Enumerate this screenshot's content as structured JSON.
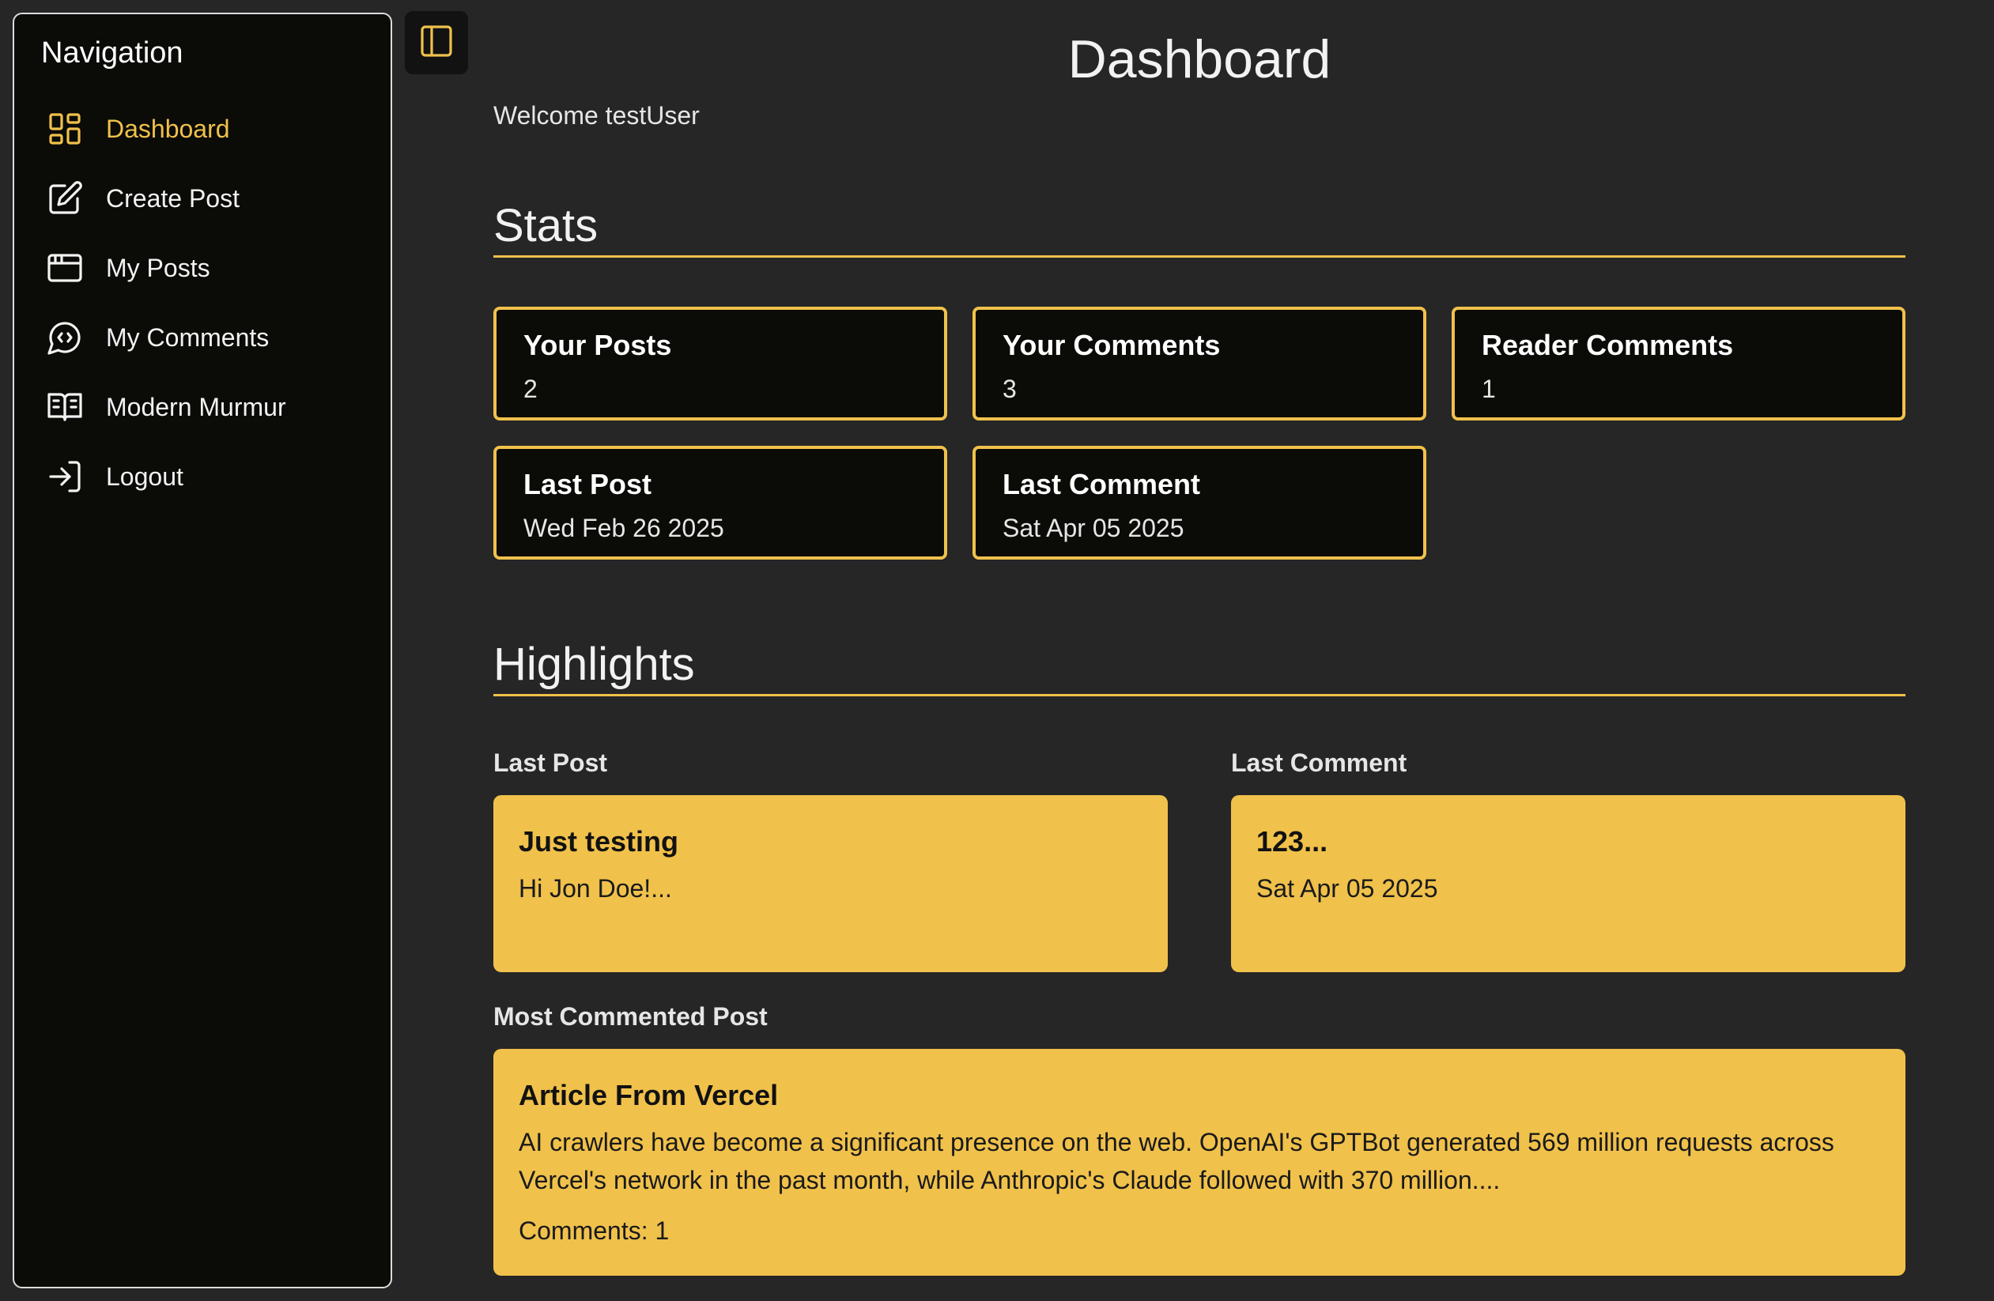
{
  "sidebar": {
    "title": "Navigation",
    "items": [
      {
        "label": "Dashboard",
        "icon": "dashboard-icon",
        "active": true
      },
      {
        "label": "Create Post",
        "icon": "edit-icon"
      },
      {
        "label": "My Posts",
        "icon": "window-icon"
      },
      {
        "label": "My Comments",
        "icon": "comment-icon"
      },
      {
        "label": "Modern Murmur",
        "icon": "book-icon"
      },
      {
        "label": "Logout",
        "icon": "logout-icon"
      }
    ]
  },
  "toolbar": {
    "toggle_icon": "sidebar-toggle-icon"
  },
  "page": {
    "title": "Dashboard",
    "welcome": "Welcome testUser"
  },
  "stats": {
    "heading": "Stats",
    "cards": [
      {
        "label": "Your Posts",
        "value": "2"
      },
      {
        "label": "Your Comments",
        "value": "3"
      },
      {
        "label": "Reader Comments",
        "value": "1"
      },
      {
        "label": "Last Post",
        "value": "Wed Feb 26 2025"
      },
      {
        "label": "Last Comment",
        "value": "Sat Apr 05 2025"
      }
    ]
  },
  "highlights": {
    "heading": "Highlights",
    "last_post": {
      "label": "Last Post",
      "title": "Just testing",
      "text": "Hi Jon Doe!..."
    },
    "last_comment": {
      "label": "Last Comment",
      "title": "123...",
      "text": "Sat Apr 05 2025"
    },
    "most_commented": {
      "label": "Most Commented Post",
      "title": "Article From Vercel",
      "text": "AI crawlers have become a significant presence on the web. OpenAI's GPTBot generated 569 million requests across Vercel's network in the past month, while Anthropic's Claude followed with 370 million....",
      "comments": "Comments: 1"
    }
  },
  "colors": {
    "accent": "#f0c14b",
    "background": "#262626",
    "sidebar": "#0b0b08"
  }
}
